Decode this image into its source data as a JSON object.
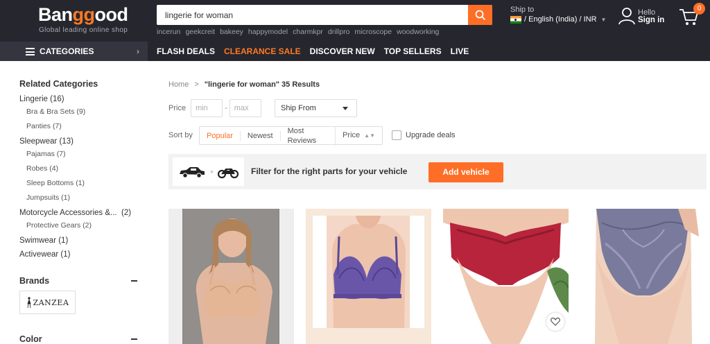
{
  "header": {
    "logo_text_1": "Ban",
    "logo_text_2": "gg",
    "logo_text_3": "ood",
    "tagline": "Global leading online shop",
    "search_value": "lingerie for woman",
    "hot_words": [
      "incerun",
      "geekcreit",
      "bakeey",
      "happymodel",
      "charmkpr",
      "drillpro",
      "microscope",
      "woodworking"
    ],
    "ship_to_label": "Ship to",
    "ship_to_value": "/ English (India) / INR",
    "hello_label": "Hello",
    "signin_label": "Sign in",
    "cart_count": "0"
  },
  "nav": {
    "categories_label": "CATEGORIES",
    "links": [
      "FLASH DEALS",
      "CLEARANCE SALE",
      "DISCOVER NEW",
      "TOP SELLERS",
      "LIVE"
    ]
  },
  "sidebar": {
    "related_title": "Related Categories",
    "groups": [
      {
        "label": "Lingerie (16)",
        "subs": [
          "Bra & Bra Sets (9)",
          "Panties (7)"
        ]
      },
      {
        "label": "Sleepwear (13)",
        "subs": [
          "Pajamas (7)",
          "Robes (4)",
          "Sleep Bottoms (1)",
          "Jumpsuits (1)"
        ]
      },
      {
        "label": "Motorcycle Accessories &...  (2)",
        "subs": [
          "Protective Gears (2)"
        ]
      },
      {
        "label": "Swimwear (1)",
        "subs": []
      },
      {
        "label": "Activewear (1)",
        "subs": []
      }
    ],
    "brands_title": "Brands",
    "brand_logo_text": "ZANZEA",
    "color_title": "Color"
  },
  "main": {
    "breadcrumb_home": "Home",
    "breadcrumb_sep": ">",
    "breadcrumb_current": "\"lingerie for woman\" 35 Results",
    "price_label": "Price",
    "price_min_placeholder": "min",
    "price_dash": "-",
    "price_max_placeholder": "max",
    "ship_from_label": "Ship From",
    "sort_label": "Sort by",
    "sort_options": [
      "Popular",
      "Newest",
      "Most Reviews",
      "Price"
    ],
    "upgrade_label": "Upgrade deals",
    "vehicle_text": "Filter for the right parts for your vehicle",
    "vehicle_plus": "+",
    "add_vehicle_label": "Add vehicle"
  },
  "colors": {
    "header_bg": "#26262f",
    "accent": "#ff6e26"
  }
}
